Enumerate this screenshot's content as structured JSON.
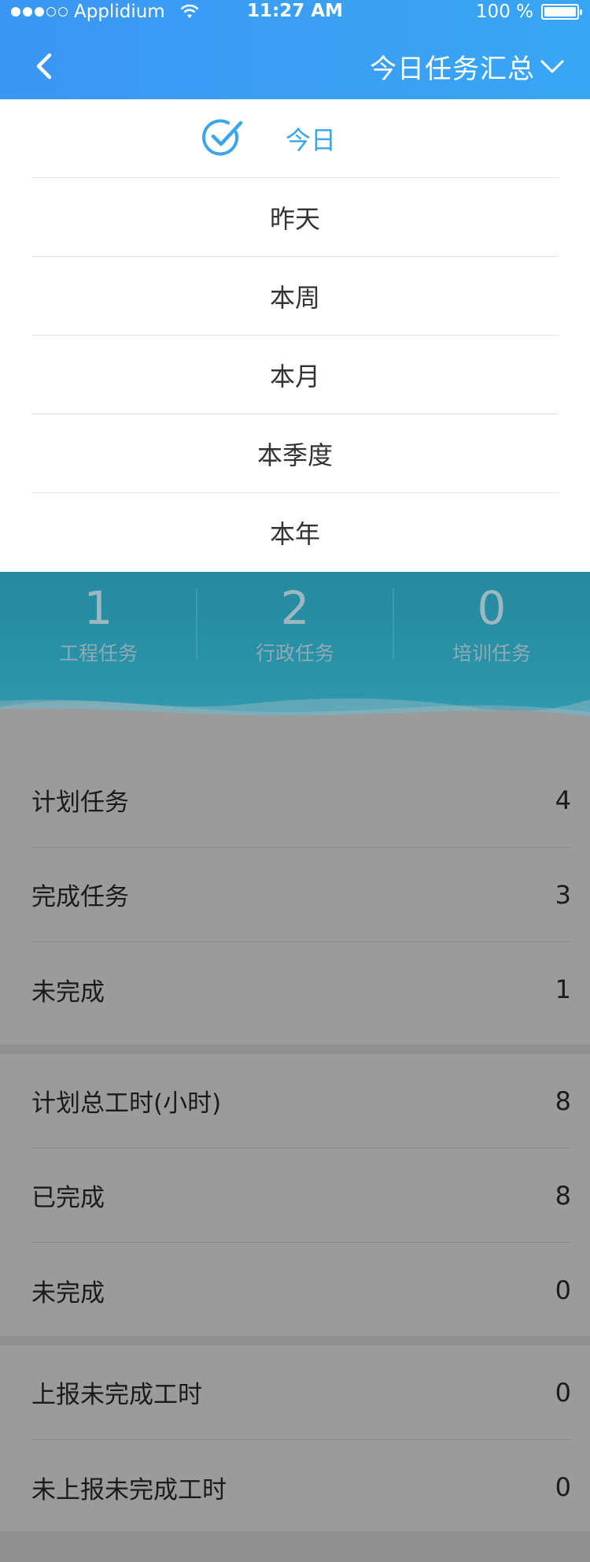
{
  "status_bar": {
    "carrier": "Applidium",
    "time": "11:27 AM",
    "battery": "100 %"
  },
  "header": {
    "title": "今日任务汇总",
    "back_icon": "chevron-left-icon",
    "dropdown_icon": "chevron-down-icon"
  },
  "dropdown": {
    "items": [
      {
        "label": "今日",
        "selected": true
      },
      {
        "label": "昨天",
        "selected": false
      },
      {
        "label": "本周",
        "selected": false
      },
      {
        "label": "本月",
        "selected": false
      },
      {
        "label": "本季度",
        "selected": false
      },
      {
        "label": "本年",
        "selected": false
      }
    ]
  },
  "stats": [
    {
      "value": "1",
      "label": "工程任务"
    },
    {
      "value": "2",
      "label": "行政任务"
    },
    {
      "value": "0",
      "label": "培训任务"
    }
  ],
  "sections": [
    {
      "rows": [
        {
          "label": "计划任务",
          "value": "4"
        },
        {
          "label": "完成任务",
          "value": "3"
        },
        {
          "label": "未完成",
          "value": "1"
        }
      ]
    },
    {
      "rows": [
        {
          "label": "计划总工时(小时)",
          "value": "8"
        },
        {
          "label": "已完成",
          "value": "8"
        },
        {
          "label": "未完成",
          "value": "0"
        }
      ]
    },
    {
      "rows": [
        {
          "label": "上报未完成工时",
          "value": "0"
        },
        {
          "label": "未上报未完成工时",
          "value": "0"
        }
      ]
    }
  ],
  "colors": {
    "header_blue": "#3a9df4",
    "selected_blue": "#3aa4ee",
    "overlay_gray": "#9b9b9b"
  }
}
